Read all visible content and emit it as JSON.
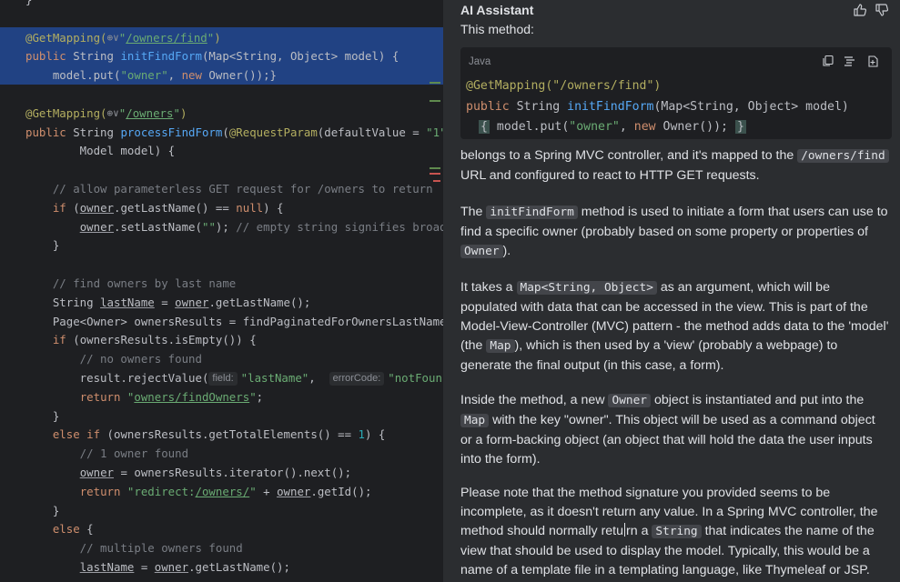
{
  "editor": {
    "lines": [
      [
        {
          "t": "}",
          "c": ""
        }
      ],
      [
        {
          "t": "",
          "c": ""
        }
      ],
      [
        {
          "t": "@GetMapping(",
          "c": "ann"
        },
        {
          "t": "⊕∨",
          "c": "globe"
        },
        {
          "t": "\"",
          "c": "str"
        },
        {
          "t": "/owners/find",
          "c": "url"
        },
        {
          "t": "\"",
          "c": "str"
        },
        {
          "t": ")",
          "c": "ann"
        }
      ],
      [
        {
          "t": "public ",
          "c": "kw"
        },
        {
          "t": "String ",
          "c": ""
        },
        {
          "t": "initFindForm",
          "c": "fn"
        },
        {
          "t": "(Map<String, Object> model) {",
          "c": ""
        }
      ],
      [
        {
          "t": "    model.put(",
          "c": ""
        },
        {
          "t": "\"owner\"",
          "c": "str"
        },
        {
          "t": ", ",
          "c": ""
        },
        {
          "t": "new ",
          "c": "kw"
        },
        {
          "t": "Owner());}",
          "c": ""
        }
      ],
      [
        {
          "t": "",
          "c": ""
        }
      ],
      [
        {
          "t": "@GetMapping(",
          "c": "ann"
        },
        {
          "t": "⊕∨",
          "c": "globe"
        },
        {
          "t": "\"",
          "c": "str"
        },
        {
          "t": "/owners",
          "c": "url"
        },
        {
          "t": "\"",
          "c": "str"
        },
        {
          "t": ")",
          "c": "ann"
        }
      ],
      [
        {
          "t": "public ",
          "c": "kw"
        },
        {
          "t": "String ",
          "c": ""
        },
        {
          "t": "processFindForm",
          "c": "fn"
        },
        {
          "t": "(",
          "c": ""
        },
        {
          "t": "@RequestParam",
          "c": "ann"
        },
        {
          "t": "(defaultValue = ",
          "c": ""
        },
        {
          "t": "\"1\"",
          "c": "str"
        }
      ],
      [
        {
          "t": "        Model model) {",
          "c": ""
        }
      ],
      [
        {
          "t": "",
          "c": ""
        }
      ],
      [
        {
          "t": "    // allow parameterless GET request for /owners to return",
          "c": "cm"
        }
      ],
      [
        {
          "t": "    ",
          "c": ""
        },
        {
          "t": "if ",
          "c": "kw"
        },
        {
          "t": "(",
          "c": ""
        },
        {
          "t": "owner",
          "c": "ul"
        },
        {
          "t": ".getLastName() == ",
          "c": ""
        },
        {
          "t": "null",
          "c": "kw"
        },
        {
          "t": ") {",
          "c": ""
        }
      ],
      [
        {
          "t": "        ",
          "c": ""
        },
        {
          "t": "owner",
          "c": "ul"
        },
        {
          "t": ".setLastName(",
          "c": ""
        },
        {
          "t": "\"\"",
          "c": "str"
        },
        {
          "t": "); ",
          "c": ""
        },
        {
          "t": "// empty string signifies broad",
          "c": "cm"
        }
      ],
      [
        {
          "t": "    }",
          "c": ""
        }
      ],
      [
        {
          "t": "",
          "c": ""
        }
      ],
      [
        {
          "t": "    // find owners by last name",
          "c": "cm"
        }
      ],
      [
        {
          "t": "    String ",
          "c": ""
        },
        {
          "t": "lastName",
          "c": "ul"
        },
        {
          "t": " = ",
          "c": ""
        },
        {
          "t": "owner",
          "c": "ul"
        },
        {
          "t": ".getLastName();",
          "c": ""
        }
      ],
      [
        {
          "t": "    Page<Owner> ownersResults = findPaginatedForOwnersLastName",
          "c": ""
        }
      ],
      [
        {
          "t": "    ",
          "c": ""
        },
        {
          "t": "if ",
          "c": "kw"
        },
        {
          "t": "(ownersResults.isEmpty()) {",
          "c": ""
        }
      ],
      [
        {
          "t": "        // no owners found",
          "c": "cm"
        }
      ],
      [
        {
          "t": "        result.rejectValue(",
          "c": ""
        },
        {
          "t": "field:",
          "c": "hint"
        },
        {
          "t": "\"lastName\"",
          "c": "str"
        },
        {
          "t": ",  ",
          "c": ""
        },
        {
          "t": "errorCode:",
          "c": "hint"
        },
        {
          "t": "\"notFoun",
          "c": "str"
        }
      ],
      [
        {
          "t": "        ",
          "c": ""
        },
        {
          "t": "return ",
          "c": "kw"
        },
        {
          "t": "\"",
          "c": "str"
        },
        {
          "t": "owners/findOwners",
          "c": "url"
        },
        {
          "t": "\"",
          "c": "str"
        },
        {
          "t": ";",
          "c": ""
        }
      ],
      [
        {
          "t": "    }",
          "c": ""
        }
      ],
      [
        {
          "t": "    ",
          "c": ""
        },
        {
          "t": "else if ",
          "c": "kw"
        },
        {
          "t": "(ownersResults.getTotalElements() == ",
          "c": ""
        },
        {
          "t": "1",
          "c": "num"
        },
        {
          "t": ") {",
          "c": ""
        }
      ],
      [
        {
          "t": "        // 1 owner found",
          "c": "cm"
        }
      ],
      [
        {
          "t": "        ",
          "c": ""
        },
        {
          "t": "owner",
          "c": "ul"
        },
        {
          "t": " = ownersResults.iterator().next();",
          "c": ""
        }
      ],
      [
        {
          "t": "        ",
          "c": ""
        },
        {
          "t": "return ",
          "c": "kw"
        },
        {
          "t": "\"redirect:",
          "c": "str"
        },
        {
          "t": "/owners/",
          "c": "url"
        },
        {
          "t": "\"",
          "c": "str"
        },
        {
          "t": " + ",
          "c": ""
        },
        {
          "t": "owner",
          "c": "ul"
        },
        {
          "t": ".getId();",
          "c": ""
        }
      ],
      [
        {
          "t": "    }",
          "c": ""
        }
      ],
      [
        {
          "t": "    ",
          "c": ""
        },
        {
          "t": "else ",
          "c": "kw"
        },
        {
          "t": "{",
          "c": ""
        }
      ],
      [
        {
          "t": "        // multiple owners found",
          "c": "cm"
        }
      ],
      [
        {
          "t": "        ",
          "c": ""
        },
        {
          "t": "lastName",
          "c": "ul"
        },
        {
          "t": " = ",
          "c": ""
        },
        {
          "t": "owner",
          "c": "ul"
        },
        {
          "t": ".getLastName();",
          "c": ""
        }
      ]
    ]
  },
  "assistant": {
    "title": "AI Assistant",
    "intro": "This method:",
    "code_card": {
      "language": "Java",
      "line1_annotation": "@GetMapping(\"/owners/find\")",
      "line2_keyword": "public",
      "line2_type": " String ",
      "line2_method": "initFindForm",
      "line2_rest": "(Map<String, Object> model)",
      "line3_open": "{",
      "line3_body_a": " model.put(",
      "line3_string": "\"owner\"",
      "line3_body_b": ", ",
      "line3_new": "new",
      "line3_body_c": " Owner());",
      "line3_close": "}"
    },
    "paragraphs": [
      [
        {
          "t": "belongs to a Spring MVC controller, and it's mapped to the "
        },
        {
          "t": "/owners/find",
          "code": true
        },
        {
          "t": " URL and configured to react to HTTP GET requests."
        }
      ],
      [
        {
          "t": "The "
        },
        {
          "t": "initFindForm",
          "code": true
        },
        {
          "t": " method is used to initiate a form that users can use to find a specific owner (probably based on some property or properties of "
        },
        {
          "t": "Owner",
          "code": true
        },
        {
          "t": ")."
        }
      ],
      [
        {
          "t": "It takes a "
        },
        {
          "t": "Map<String, Object>",
          "code": true
        },
        {
          "t": " as an argument, which will be populated with data that can be accessed in the view. This is part of the Model-View-Controller (MVC) pattern - the method adds data to the 'model' (the "
        },
        {
          "t": "Map",
          "code": true
        },
        {
          "t": "), which is then used by a 'view' (probably a webpage) to generate the final output (in this case, a form)."
        }
      ],
      [
        {
          "t": "Inside the method, a new "
        },
        {
          "t": "Owner",
          "code": true
        },
        {
          "t": " object is instantiated and put into the "
        },
        {
          "t": "Map",
          "code": true
        },
        {
          "t": " with the key \"owner\". This object will be used as a command object or a form-backing object (an object that will hold the data the user inputs into the form)."
        }
      ],
      [
        {
          "t": "Please note that the method signature you provided seems to be incomplete, as it doesn't return any value. In a Spring MVC controller, the method should normally retu"
        },
        {
          "t": "",
          "cursor": true
        },
        {
          "t": "rn a "
        },
        {
          "t": "String",
          "code": true
        },
        {
          "t": " that indicates the name of the view that should be used to display the model. Typically, this would be a name of a template file in a templating language, like Thymeleaf or JSP."
        }
      ]
    ],
    "icons": [
      "thumbs-up-icon",
      "thumbs-down-icon",
      "copy-icon",
      "format-icon",
      "insert-icon"
    ]
  },
  "colors": {
    "editor_bg": "#1e1f22",
    "panel_bg": "#2b2d30",
    "selection": "#214283",
    "keyword": "#cf8e6d",
    "annotation": "#b3ae60",
    "string": "#6aab73",
    "method": "#56a8f5"
  }
}
